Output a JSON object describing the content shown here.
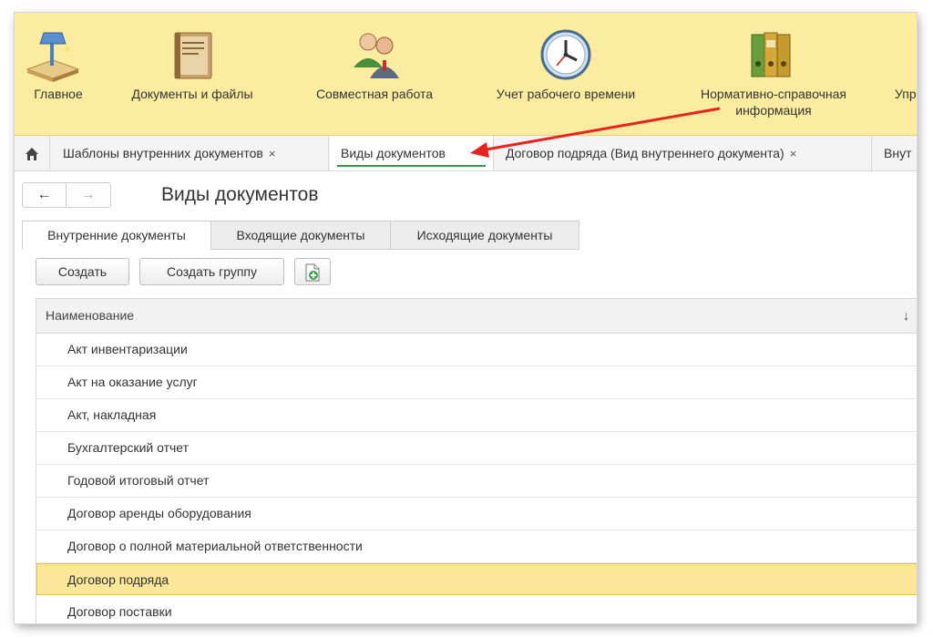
{
  "sections": [
    {
      "label": "Главное",
      "icon": "desk-lamp-icon"
    },
    {
      "label": "Документы и файлы",
      "icon": "document-book-icon"
    },
    {
      "label": "Совместная работа",
      "icon": "people-icon"
    },
    {
      "label": "Учет рабочего времени",
      "icon": "clock-icon"
    },
    {
      "label": "Нормативно-справочная информация",
      "label_line1": "Нормативно-справочная",
      "label_line2": "информация",
      "icon": "binders-icon"
    },
    {
      "label": "Упр",
      "icon": ""
    }
  ],
  "tabs": [
    {
      "label": "Шаблоны внутренних документов",
      "close": "×"
    },
    {
      "label": "Виды документов",
      "active": true
    },
    {
      "label": "Договор подряда (Вид внутреннего документа)",
      "close": "×"
    },
    {
      "label": "Внут"
    }
  ],
  "nav": {
    "back": "←",
    "forward": "→"
  },
  "page": {
    "title": "Виды документов"
  },
  "inner_tabs": [
    {
      "label": "Внутренние документы",
      "active": true
    },
    {
      "label": "Входящие документы"
    },
    {
      "label": "Исходящие документы"
    }
  ],
  "commands": {
    "create": "Создать",
    "create_group": "Создать группу"
  },
  "table": {
    "column": "Наименование",
    "sort_indicator": "↓",
    "rows": [
      "Акт инвентаризации",
      "Акт на оказание услуг",
      "Акт, накладная",
      "Бухгалтерский отчет",
      "Годовой итоговый отчет",
      "Договор аренды оборудования",
      "Договор о полной материальной ответственности",
      "Договор подряда",
      "Договор поставки"
    ],
    "selected_row": "Договор подряда"
  },
  "colors": {
    "panel": "#fbeca0",
    "accent_underline": "#2e9b45",
    "arrow": "#e8231f",
    "selection": "#fbe69a"
  }
}
